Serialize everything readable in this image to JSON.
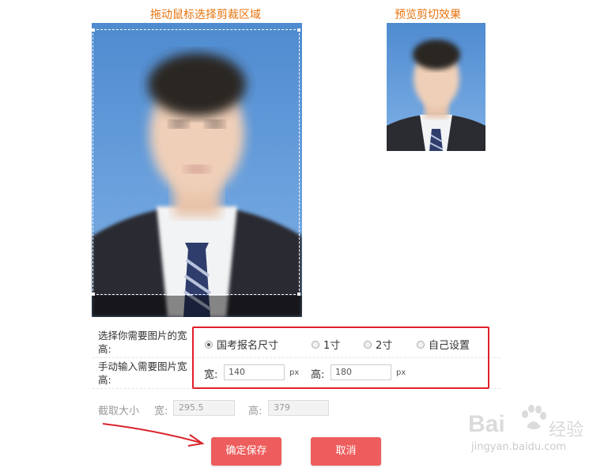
{
  "titles": {
    "crop_area": "拖动鼠标选择剪裁区域",
    "preview": "预览剪切效果"
  },
  "form": {
    "size_label": "选择你需要图片的宽高:",
    "manual_label": "手动输入需要图片宽高:",
    "radios": [
      {
        "label": "国考报名尺寸",
        "checked": true
      },
      {
        "label": "1寸",
        "checked": false
      },
      {
        "label": "2寸",
        "checked": false
      },
      {
        "label": "自己设置",
        "checked": false
      }
    ],
    "width_label": "宽:",
    "width_value": "140",
    "height_label": "高:",
    "height_value": "180",
    "unit": "px"
  },
  "crop_size": {
    "label": "截取大小",
    "width_label": "宽:",
    "width_value": "295.5",
    "height_label": "高:",
    "height_value": "379"
  },
  "buttons": {
    "save": "确定保存",
    "cancel": "取消"
  },
  "watermark": {
    "brand": "Bai",
    "brand_cn": "经验",
    "url": "jingyan.baidu.com"
  },
  "colors": {
    "title_orange": "#e8730c",
    "highlight_red": "#e0202a",
    "button_red": "#ee5d5d",
    "photo_bg_blue": "#5b95d4"
  }
}
